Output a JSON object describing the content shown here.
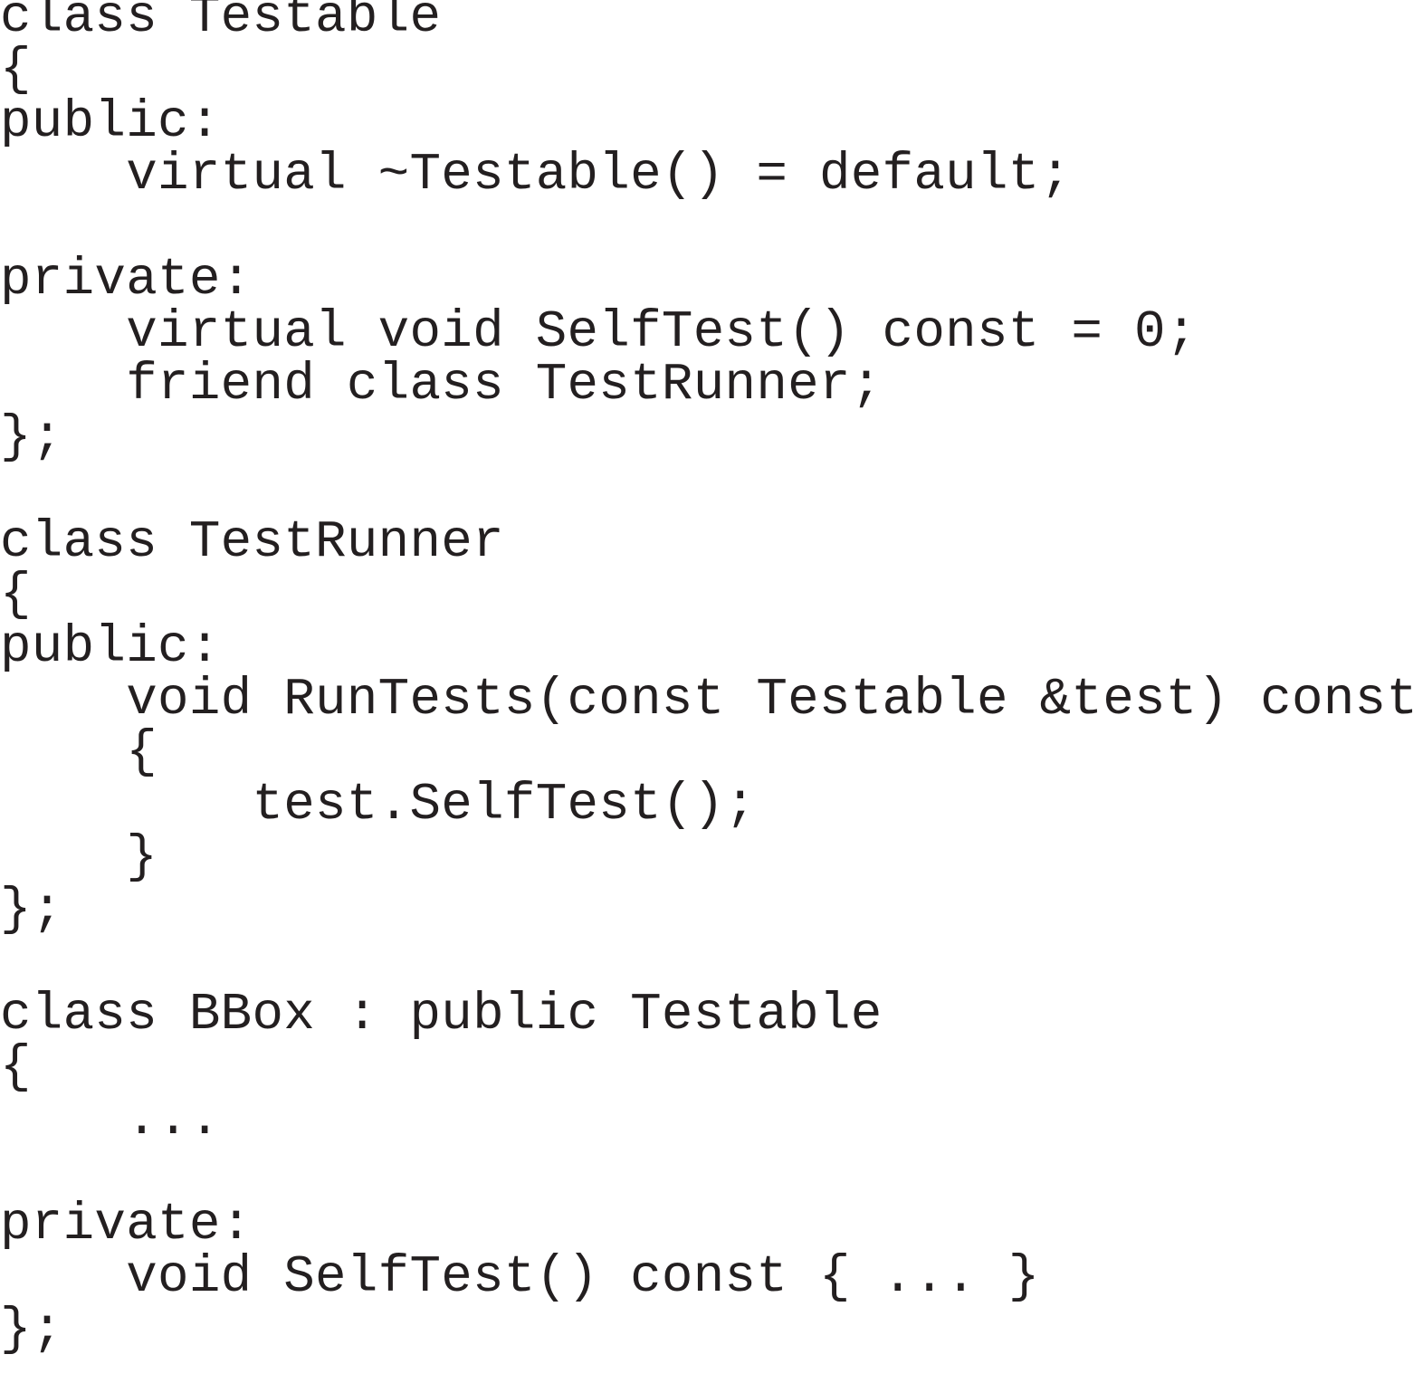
{
  "code": {
    "lines": [
      "class Testable",
      "{",
      "public:",
      "    virtual ~Testable() = default;",
      "",
      "private:",
      "    virtual void SelfTest() const = 0;",
      "    friend class TestRunner;",
      "};",
      "",
      "class TestRunner",
      "{",
      "public:",
      "    void RunTests(const Testable &test) const",
      "    {",
      "        test.SelfTest();",
      "    }",
      "};",
      "",
      "class BBox : public Testable",
      "{",
      "    ...",
      "",
      "private:",
      "    void SelfTest() const { ... }",
      "};"
    ]
  }
}
